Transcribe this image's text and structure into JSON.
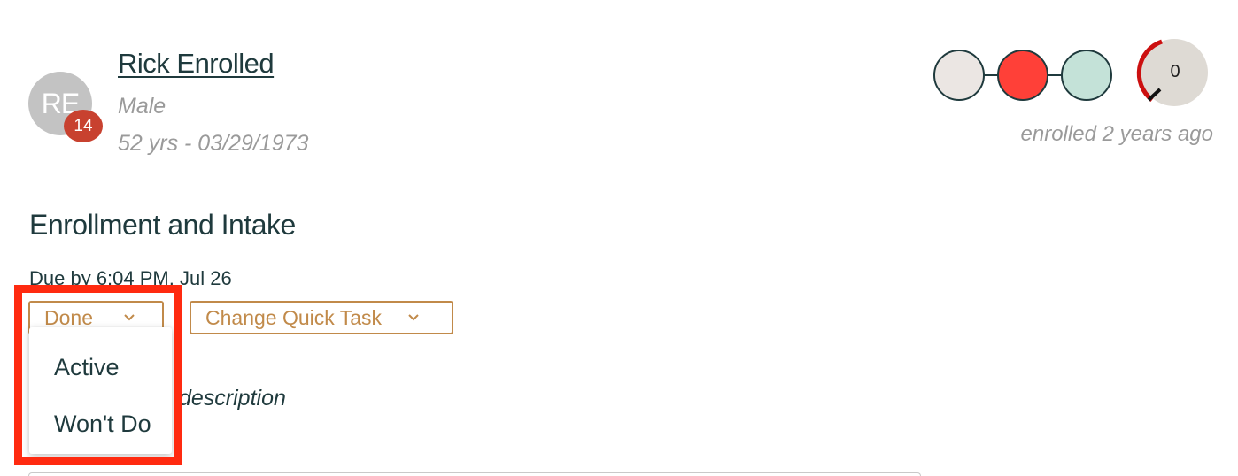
{
  "patient": {
    "initials": "RE",
    "badge_count": "14",
    "name": "Rick Enrolled",
    "sex": "Male",
    "age_dob": "52 yrs - 03/29/1973"
  },
  "status": {
    "dots": [
      {
        "name": "status-dot-1",
        "color": "#ebe6e3"
      },
      {
        "name": "status-dot-2",
        "color": "#ff4038"
      },
      {
        "name": "status-dot-3",
        "color": "#c4e2d8"
      }
    ],
    "gauge_value": "0",
    "gauge_colors": {
      "arc": "#cc1010",
      "fill": "#dedad4",
      "needle": "#111111"
    },
    "enrolled_text": "enrolled 2 years ago"
  },
  "task": {
    "title": "Enrollment and Intake",
    "due": "Due by 6:04 PM, Jul 26",
    "status_button_label": "Done",
    "quick_task_button_label": "Change Quick Task",
    "description_fragment": "description"
  },
  "status_menu": {
    "options": [
      "Active",
      "Won't Do"
    ]
  },
  "colors": {
    "accent": "#c18a4a",
    "text_primary": "#1f3a3d",
    "muted": "#9a9a9a",
    "badge": "#c8412f",
    "highlight": "#ff2a10"
  },
  "icons": {
    "button_chevron": "chevron-down-icon"
  }
}
